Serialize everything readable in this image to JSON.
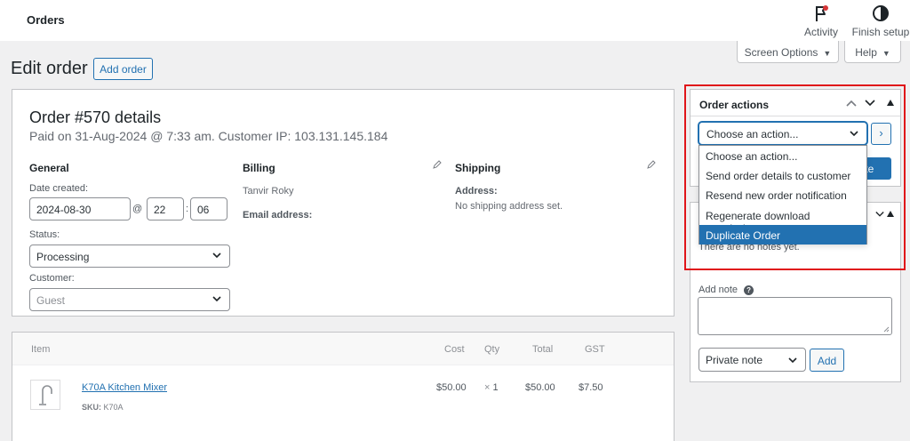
{
  "topbar": {
    "title": "Orders",
    "activity_label": "Activity",
    "finish_setup_label": "Finish setup"
  },
  "screen_options": {
    "screen_options_label": "Screen Options",
    "help_label": "Help"
  },
  "page": {
    "title": "Edit order",
    "add_order_label": "Add order"
  },
  "order": {
    "heading": "Order #570 details",
    "subheading": "Paid on 31-Aug-2024 @ 7:33 am. Customer IP: 103.131.145.184",
    "general": {
      "heading": "General",
      "date_created_label": "Date created:",
      "date_value": "2024-08-30",
      "at_symbol": "@",
      "hour": "22",
      "colon": ":",
      "minute": "06",
      "status_label": "Status:",
      "status_value": "Processing",
      "customer_label": "Customer:",
      "customer_value": "Guest"
    },
    "billing": {
      "heading": "Billing",
      "name": "Tanvir Roky",
      "email_label": "Email address:"
    },
    "shipping": {
      "heading": "Shipping",
      "address_label": "Address:",
      "address_value": "No shipping address set."
    }
  },
  "items": {
    "columns": {
      "item": "Item",
      "cost": "Cost",
      "qty": "Qty",
      "total": "Total",
      "gst": "GST"
    },
    "rows": [
      {
        "name": "K70A Kitchen Mixer",
        "sku_label": "SKU:",
        "sku": "K70A",
        "cost": "$50.00",
        "qty_x": "×",
        "qty": "1",
        "total": "$50.00",
        "gst": "$7.50"
      }
    ]
  },
  "order_actions": {
    "title": "Order actions",
    "selected": "Choose an action...",
    "go_label": "›",
    "update_label": "date",
    "options": [
      "Choose an action...",
      "Send order details to customer",
      "Resend new order notification",
      "Regenerate download permissions",
      "Duplicate Order"
    ],
    "highlighted_index": 4
  },
  "notes": {
    "empty_text": "There are no notes yet.",
    "add_note_label": "Add note",
    "help_glyph": "?",
    "note_type": "Private note",
    "add_label": "Add"
  },
  "colors": {
    "accent": "#2271b1",
    "highlight_box": "#e0151a",
    "notification_dot": "#d63638"
  }
}
